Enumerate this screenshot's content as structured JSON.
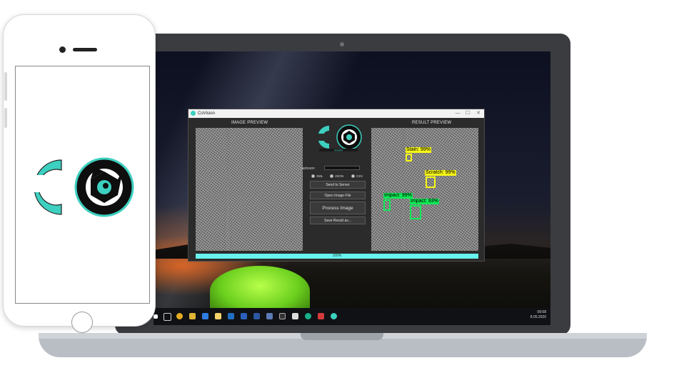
{
  "colors": {
    "accent": "#3dcfbf",
    "progress": "#68f3ee",
    "det_green": "#19e05a",
    "det_yellow": "#ecec20"
  },
  "app": {
    "title": "CoVision",
    "window_controls": [
      "—",
      "☐",
      "✕"
    ],
    "image_preview_label": "IMAGE PREVIEW",
    "result_preview_label": "RESULT PREVIEW",
    "logo_caption": "VISION",
    "server_label": "SERVER:",
    "server_value": "",
    "formats": [
      "XML",
      "JSON",
      "CSV"
    ],
    "buttons": {
      "send": "Send to Server",
      "open": "Open Image File",
      "process": "Process Image",
      "save": "Save Result as..."
    },
    "progress": {
      "text": "100%",
      "value": 100
    },
    "detections": [
      {
        "label": "Stain: 99%",
        "class": "yellow"
      },
      {
        "label": "Scratch: 99%",
        "class": "yellow"
      },
      {
        "label": "Impact: 99%",
        "class": "green"
      },
      {
        "label": "Impact: 93%",
        "class": "green"
      }
    ]
  },
  "taskbar": {
    "icons": [
      "search-icon",
      "task-view-icon",
      "chrome-icon",
      "folder-icon",
      "edge-icon",
      "file-explorer-icon",
      "store-icon",
      "mail-icon",
      "word-icon",
      "photos-icon",
      "terminal-icon",
      "app-icon",
      "green-app-icon",
      "pdf-icon",
      "covision-icon"
    ],
    "time": "09:58",
    "date": "8.05.2020"
  }
}
